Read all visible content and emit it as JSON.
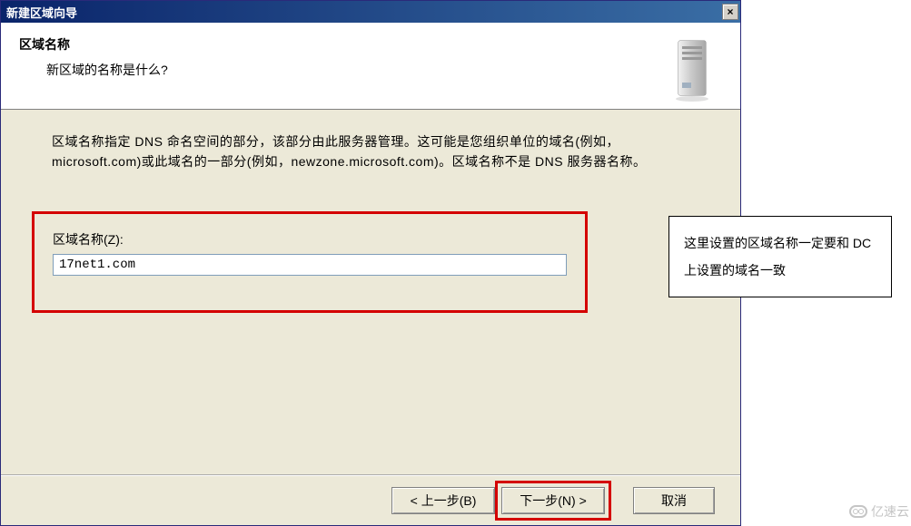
{
  "titlebar": {
    "title": "新建区域向导",
    "close": "×"
  },
  "header": {
    "title": "区域名称",
    "subtitle": "新区域的名称是什么?"
  },
  "body": {
    "description": "区域名称指定 DNS 命名空间的部分，该部分由此服务器管理。这可能是您组织单位的域名(例如，microsoft.com)或此域名的一部分(例如，newzone.microsoft.com)。区域名称不是 DNS 服务器名称。"
  },
  "form": {
    "label": "区域名称(Z):",
    "value": "17net1.com"
  },
  "buttons": {
    "back": "< 上一步(B)",
    "next": "下一步(N) >",
    "cancel": "取消"
  },
  "annotation": {
    "text": "这里设置的区域名称一定要和 DC 上设置的域名一致"
  },
  "watermark": {
    "text": "亿速云"
  }
}
